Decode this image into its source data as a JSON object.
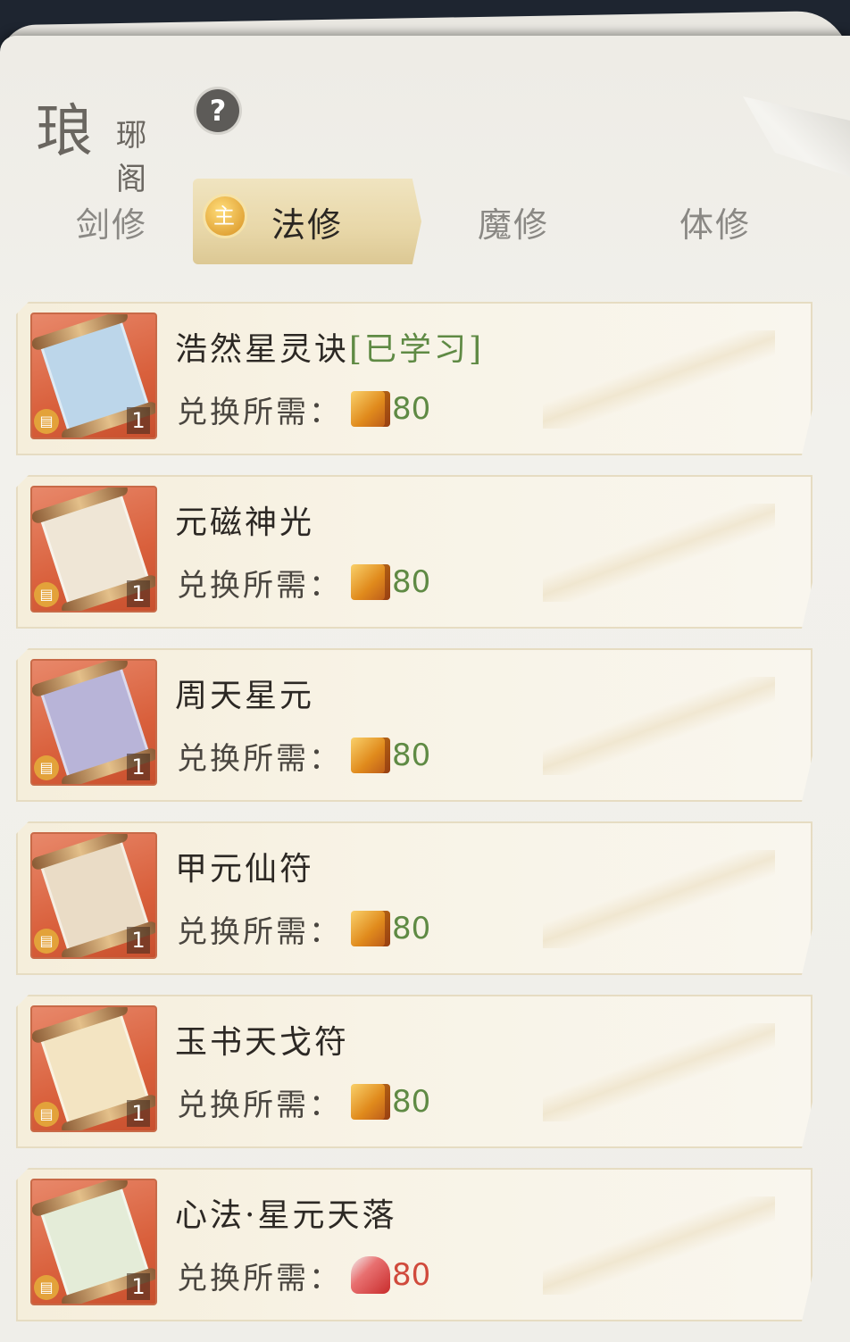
{
  "header": {
    "title_char": "琅",
    "title_rest": "琊阁",
    "help_label": "?"
  },
  "tabs": [
    {
      "label": "剑修",
      "active": false
    },
    {
      "label": "法修",
      "active": true,
      "badge": "主"
    },
    {
      "label": "魔修",
      "active": false
    },
    {
      "label": "体修",
      "active": false
    }
  ],
  "cost_label": "兑换所需：",
  "items": [
    {
      "name": "浩然星灵诀",
      "status": "[已学习]",
      "count": "1",
      "price": "80",
      "currency": "gold-book-icon",
      "scroll_color": "#bcd6ea"
    },
    {
      "name": "元磁神光",
      "status": "",
      "count": "1",
      "price": "80",
      "currency": "gold-book-icon",
      "scroll_color": "#efe6d6"
    },
    {
      "name": "周天星元",
      "status": "",
      "count": "1",
      "price": "80",
      "currency": "gold-book-icon",
      "scroll_color": "#b8b4d8"
    },
    {
      "name": "甲元仙符",
      "status": "",
      "count": "1",
      "price": "80",
      "currency": "gold-book-icon",
      "scroll_color": "#eadcc6"
    },
    {
      "name": "玉书天戈符",
      "status": "",
      "count": "1",
      "price": "80",
      "currency": "gold-book-icon",
      "scroll_color": "#f3e4c2"
    },
    {
      "name": "心法·星元天落",
      "status": "",
      "count": "1",
      "price": "80",
      "currency": "red-ticket-icon",
      "scroll_color": "#e4ecd8"
    }
  ],
  "colors": {
    "learned_text": "#5f8a44",
    "price_green": "#5f8a44",
    "price_red": "#d04a3c",
    "active_tab": "#e8d7a8"
  }
}
